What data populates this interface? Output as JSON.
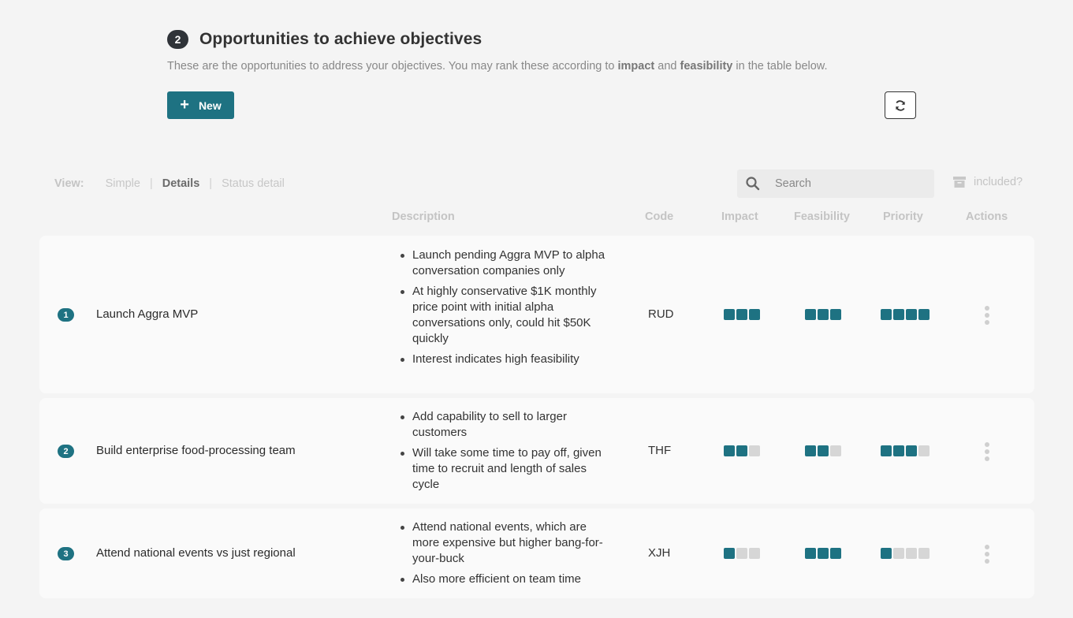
{
  "header": {
    "step": "2",
    "title": "Opportunities to achieve objectives",
    "subtitle_before": "These are the opportunities to address your objectives. You may rank these according to ",
    "subtitle_bold1": "impact",
    "subtitle_mid": " and ",
    "subtitle_bold2": "feasibility",
    "subtitle_after": " in the table below."
  },
  "toolbar": {
    "new_label": "New",
    "refresh_icon": "refresh-icon"
  },
  "view": {
    "label": "View:",
    "options": [
      "Simple",
      "Details",
      "Status detail"
    ],
    "active": "Details",
    "sep": "|"
  },
  "search": {
    "placeholder": "Search",
    "value": ""
  },
  "included": {
    "label": "included?"
  },
  "columns": {
    "description": "Description",
    "code": "Code",
    "impact": "Impact",
    "feasibility": "Feasibility",
    "priority": "Priority",
    "actions": "Actions"
  },
  "colors": {
    "accent": "#1e7282",
    "empty": "#d6d6d6"
  },
  "rows": [
    {
      "num": "1",
      "name": "Launch Aggra MVP",
      "desc": [
        "Launch pending Aggra MVP to alpha conversation companies only",
        "At highly conservative $1K monthly price point with initial alpha conversations only, could hit $50K quickly",
        "Interest indicates high feasibility"
      ],
      "code": "RUD",
      "impact": {
        "value": 3,
        "max": 3
      },
      "feasibility": {
        "value": 3,
        "max": 3
      },
      "priority": {
        "value": 4,
        "max": 4
      }
    },
    {
      "num": "2",
      "name": "Build enterprise food-processing team",
      "desc": [
        "Add capability to sell to larger customers",
        "Will take some time to pay off, given time to recruit and length of sales cycle"
      ],
      "code": "THF",
      "impact": {
        "value": 2,
        "max": 3
      },
      "feasibility": {
        "value": 2,
        "max": 3
      },
      "priority": {
        "value": 3,
        "max": 4
      }
    },
    {
      "num": "3",
      "name": "Attend national events vs just regional",
      "desc": [
        "Attend national events, which are more expensive but higher bang-for-your-buck",
        "Also more efficient on team time"
      ],
      "code": "XJH",
      "impact": {
        "value": 1,
        "max": 3
      },
      "feasibility": {
        "value": 3,
        "max": 3
      },
      "priority": {
        "value": 1,
        "max": 4
      }
    }
  ]
}
